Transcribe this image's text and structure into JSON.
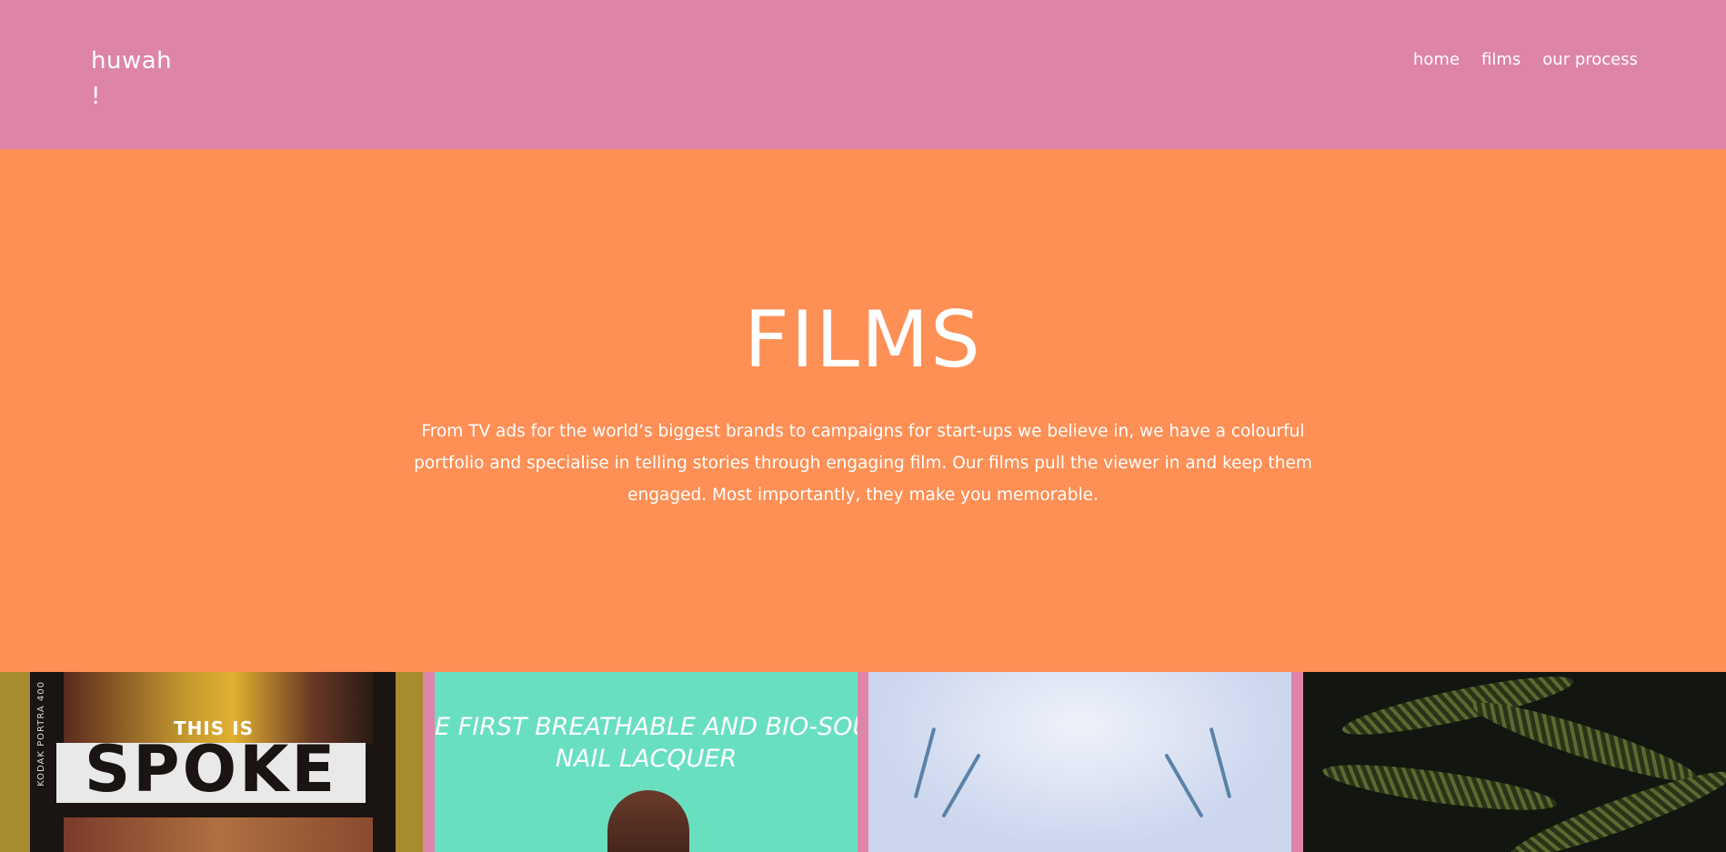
{
  "header": {
    "logo_line1": "huwah",
    "logo_line2": "!",
    "nav": [
      {
        "label": "home"
      },
      {
        "label": "films"
      },
      {
        "label": "our process"
      }
    ]
  },
  "hero": {
    "title": "FILMS",
    "description": "From TV ads for the world’s biggest brands to campaigns for start-ups we believe in, we have a colourful portfolio and specialise in telling stories through engaging film. Our films pull the viewer in and keep them engaged. Most importantly, they make you memorable."
  },
  "films": [
    {
      "overlay_line1": "THIS IS",
      "overlay_line2": "SPOKE",
      "side_text": "KODAK PORTRA 400"
    },
    {
      "overlay_line1": "E FIRST BREATHABLE AND BIO-SOURC",
      "overlay_line2": "NAIL LACQUER"
    },
    {},
    {}
  ],
  "colors": {
    "header_bg": "#de84a8",
    "hero_bg": "#fe8f55",
    "text": "#ffffff"
  }
}
